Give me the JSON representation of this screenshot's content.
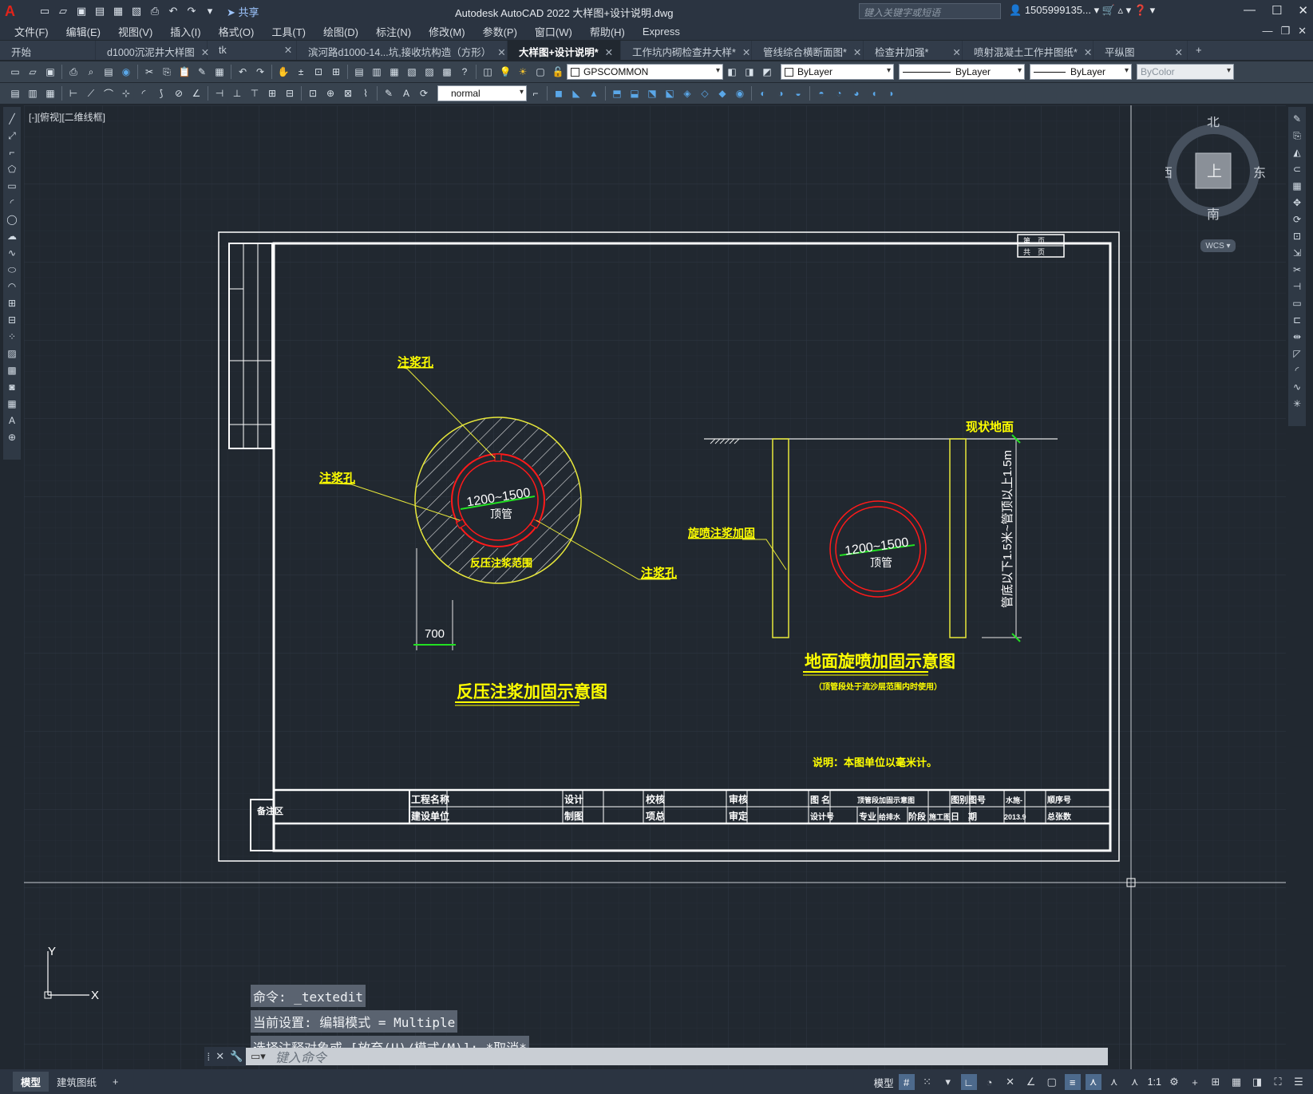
{
  "app": {
    "logo": "A",
    "title": "Autodesk AutoCAD 2022    大样图+设计说明.dwg",
    "share_label": "共享",
    "search_placeholder": "键入关键字或短语",
    "user_name": "1505999135...",
    "win_min": "—",
    "win_max": "☐",
    "win_close": "✕"
  },
  "menu": [
    "文件(F)",
    "编辑(E)",
    "视图(V)",
    "插入(I)",
    "格式(O)",
    "工具(T)",
    "绘图(D)",
    "标注(N)",
    "修改(M)",
    "参数(P)",
    "窗口(W)",
    "帮助(H)",
    "Express"
  ],
  "tabs": [
    {
      "label": "开始",
      "active": false
    },
    {
      "label": "d1000沉泥井大样图",
      "active": false
    },
    {
      "label": "tk",
      "active": false
    },
    {
      "label": "滨河路d1000-14...坑,接收坑构造（方形）",
      "active": false
    },
    {
      "label": "大样图+设计说明*",
      "active": true
    },
    {
      "label": "工作坑内砌检查井大样*",
      "active": false
    },
    {
      "label": "管线综合横断面图*",
      "active": false
    },
    {
      "label": "检查井加强*",
      "active": false
    },
    {
      "label": "喷射混凝土工作井图纸*",
      "active": false
    },
    {
      "label": "平纵图",
      "active": false
    }
  ],
  "toolbar": {
    "layer_name": "GPSCOMMON",
    "color_value": "ByLayer",
    "linetype_value": "ByLayer",
    "lineweight_value": "ByLayer",
    "plotstyle_value": "ByColor",
    "textstyle_value": "normal"
  },
  "viewport": {
    "label": "[-][俯视][二维线框]"
  },
  "viewcube": {
    "north": "北",
    "south": "南",
    "east": "东",
    "west": "西",
    "top": "上",
    "wcs": "WCS"
  },
  "drawing": {
    "left_label_top": "注浆孔",
    "left_label_mid": "注浆孔",
    "left_label_right": "注浆孔",
    "pipe_size": "1200~1500",
    "pipe_name": "顶管",
    "zone_label": "反压注浆范围",
    "dim_700": "700",
    "left_title": "反压注浆加固示意图",
    "ground_label": "现状地面",
    "jet_label": "旋喷注浆加固",
    "depth_label": "管底以下1.5米~管顶以上1.5m",
    "right_pipe_size": "1200~1500",
    "right_pipe_name": "顶管",
    "right_title": "地面旋喷加固示意图",
    "right_subtitle": "（顶管段处于流沙层范围内时使用）",
    "note": "说明：本图单位以毫米计。",
    "tb_project": "工程名称",
    "tb_owner": "建设单位",
    "tb_design": "设计",
    "tb_draw": "制图",
    "tb_check": "校核",
    "tb_chief": "项总",
    "tb_review": "审核",
    "tb_approve": "审定",
    "tb_name": "图 名",
    "tb_dwg_title": "顶管段加固示意图",
    "tb_design_no": "设计号",
    "tb_major": "专业",
    "tb_major_val": "给排水",
    "tb_stage": "阶段",
    "tb_stage_val": "施工图",
    "tb_sheet": "图别图号",
    "tb_sheet_val": "水施-",
    "tb_date": "日　期",
    "tb_date_val": "2013.9",
    "tb_seq": "顺序号",
    "tb_total": "总张数",
    "tb_remark": "备注区",
    "corner_sheet": "第　页",
    "corner_total": "共　页"
  },
  "ucs": {
    "x": "X",
    "y": "Y"
  },
  "command": {
    "history": [
      "命令: _textedit",
      "当前设置: 编辑模式 = Multiple",
      "选择注释对象或 [放弃(U)/模式(M)]: *取消*"
    ],
    "placeholder": "键入命令"
  },
  "status": {
    "layout_tabs": [
      "模型",
      "建筑图纸"
    ],
    "model_label": "模型",
    "scale": "1:1"
  },
  "colors": {
    "background": "#212830",
    "yellow": "#ffff00",
    "red": "#ff1a1a",
    "green": "#22e022",
    "white": "#ffffff"
  }
}
